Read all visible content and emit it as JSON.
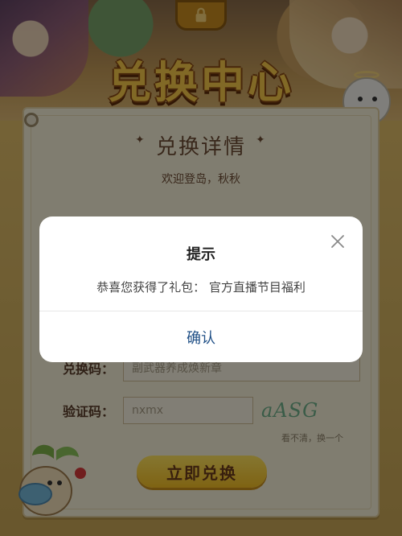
{
  "banner": {
    "title": "兑换中心"
  },
  "form": {
    "section_title": "兑换详情",
    "welcome": "欢迎登岛，秋秋",
    "code_label": "兑换码：",
    "code_value": "副武器养成焕新章",
    "captcha_label": "验证码：",
    "captcha_value": "nxmx",
    "captcha_text": "aASG",
    "refresh_text": "看不清，换一个",
    "submit_label": "立即兑换"
  },
  "modal": {
    "title": "提示",
    "message": "恭喜您获得了礼包：  官方直播节目福利",
    "confirm_label": "确认"
  },
  "colors": {
    "overlay": "#000000",
    "confirm_text": "#1f4f86",
    "title_gold": "#f7c94a",
    "button_yellow": "#f3be25"
  }
}
